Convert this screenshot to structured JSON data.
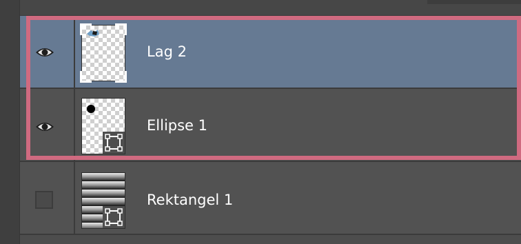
{
  "layers_panel": {
    "layers": [
      {
        "name": "Lag 2",
        "visible": true,
        "selected": true,
        "visibility_icon": "eye-icon",
        "thumbnail": "transparent-layer-thumbnail"
      },
      {
        "name": "Ellipse 1",
        "visible": true,
        "selected": false,
        "visibility_icon": "eye-icon",
        "thumbnail": "transparent-layer-thumbnail-with-shape",
        "badge_icon": "vector-mask-icon"
      },
      {
        "name": "Rektangel 1",
        "visible": false,
        "selected": false,
        "visibility_icon": "empty-visibility-box",
        "thumbnail": "gradient-thumbnail",
        "badge_icon": "vector-mask-icon"
      }
    ],
    "highlight_color": "#d06a80",
    "selected_row_color": "#667a93",
    "row_color": "#525252"
  }
}
